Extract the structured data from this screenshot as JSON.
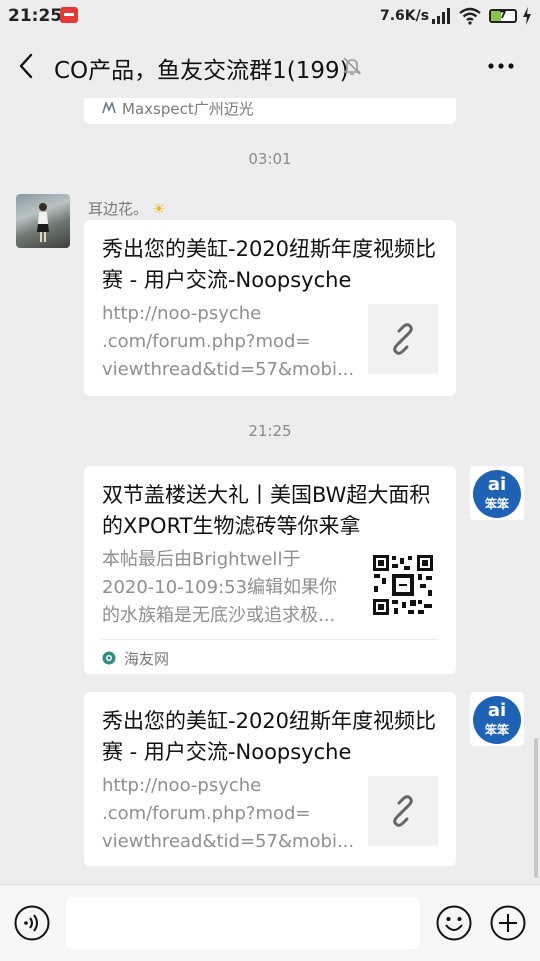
{
  "status_bar": {
    "time": "21:25",
    "net_speed": "7.6K/s",
    "battery": "7"
  },
  "header": {
    "title": "CO产品，鱼友交流群1(199)"
  },
  "messages": {
    "prev_source": "Maxspect广州迈光",
    "time1": "03:01",
    "sender1": "耳边花。",
    "card1": {
      "title": "秀出您的美缸-2020纽斯年度视频比赛 - 用户交流-Noopsyche",
      "desc_line1": "http://noo-psyche",
      "desc_line2": ".com/forum.php?mod=",
      "desc_line3": "viewthread&tid=57&mobi..."
    },
    "time2": "21:25",
    "card2": {
      "title": "双节盖楼送大礼丨美国BW超大面积的XPORT生物滤砖等你来拿",
      "desc_line1": "本帖最后由Brightwell于",
      "desc_line2": "2020-10-109:53编辑如果你",
      "desc_line3": "的水族箱是无底沙或追求极...",
      "source": "海友网"
    },
    "card3": {
      "title": "秀出您的美缸-2020纽斯年度视频比赛 - 用户交流-Noopsyche",
      "desc_line1": "http://noo-psyche",
      "desc_line2": ".com/forum.php?mod=",
      "desc_line3": "viewthread&tid=57&mobi..."
    },
    "avatar_text": "ai",
    "avatar_subtext": "笨笨"
  },
  "input": {
    "value": "",
    "placeholder": ""
  },
  "colors": {
    "background": "#ededed",
    "card": "#ffffff",
    "meta_text": "#8a8a8a",
    "avatar_blue": "#1e62b5"
  },
  "icons": {
    "back": "chevron-left-icon",
    "mute": "bell-off-icon",
    "more": "more-horizontal-icon",
    "link": "link-icon",
    "voice": "voice-icon",
    "emoji": "emoji-icon",
    "plus": "plus-icon"
  }
}
